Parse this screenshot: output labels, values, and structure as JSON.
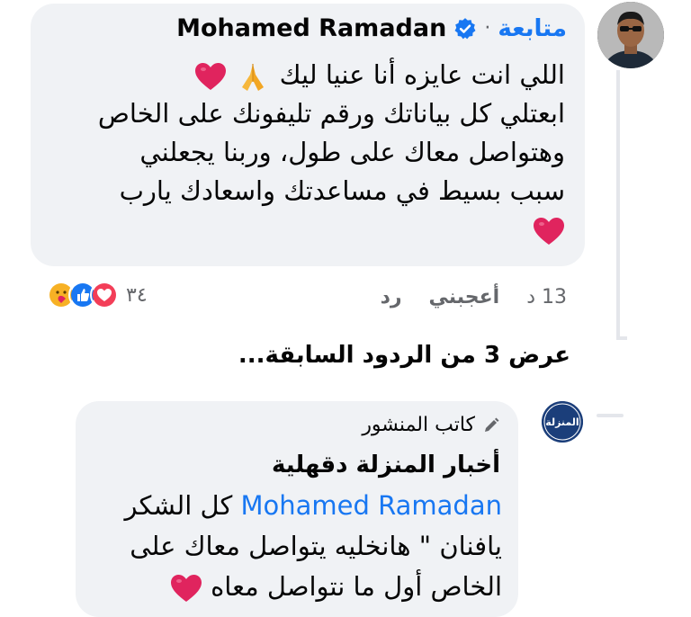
{
  "comment": {
    "follow_label": "متابعة",
    "separator": "·",
    "author_name": "Mohamed Ramadan",
    "lines": [
      "اللي انت عايزه أنا عنيا ليك",
      "ابعتلي كل بياناتك ورقم تليفونك على الخاص",
      "وهتواصل معاك على طول، وربنا يجعلني",
      "سبب بسيط في مساعدتك واسعادك يارب"
    ],
    "time": "13 د",
    "like_label": "أعجبني",
    "reply_label": "رد",
    "reaction_count": "٣٤",
    "reaction_icons": [
      "care-icon",
      "like-icon",
      "love-icon"
    ]
  },
  "thread": {
    "view_more": "عرض 3 من الردود السابقة..."
  },
  "reply": {
    "author_badge": "كاتب المنشور",
    "page_name": "أخبار المنزلة دقهلية",
    "mention": "Mohamed Ramadan",
    "line1_suffix": "كل الشكر",
    "line2": "يافنان \" هانخليه يتواصل معاك على",
    "line3": "الخاص أول ما نتواصل معاه",
    "avatar_text": "المنزلة"
  },
  "colors": {
    "accent": "#1877f2",
    "bubble": "#f0f2f5",
    "heart": "#e0245e",
    "muted": "#65676b"
  }
}
